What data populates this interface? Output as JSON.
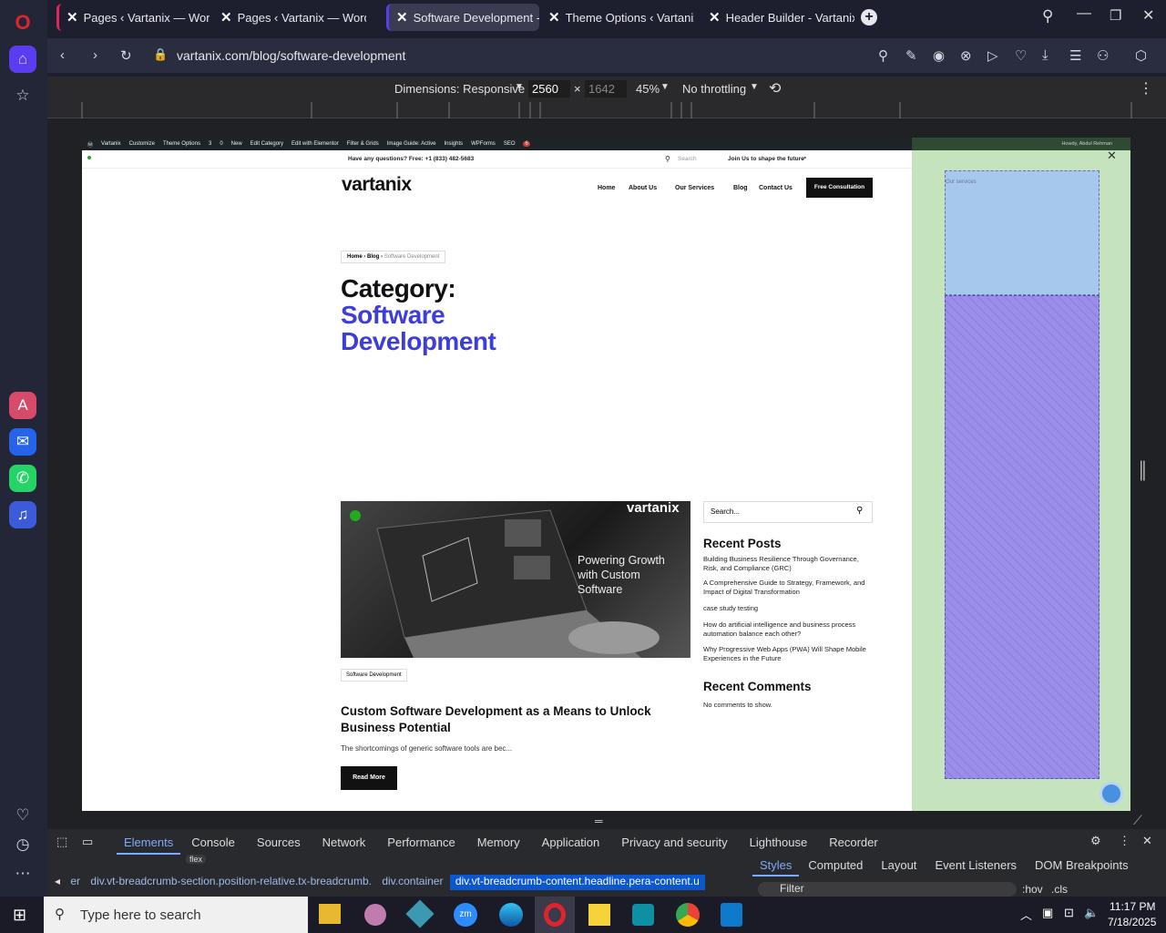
{
  "browser": {
    "tabs": [
      {
        "title": "Pages ‹ Vartanix — WordP"
      },
      {
        "title": "Pages ‹ Vartanix — WordP"
      },
      {
        "title": "Software Development - V"
      },
      {
        "title": "Theme Options ‹ Vartanix"
      },
      {
        "title": "Header Builder - Vartanix"
      }
    ],
    "url": "vartanix.com/blog/software-development"
  },
  "devtools_toolbar": {
    "dimensions": "Dimensions: Responsive",
    "width": "2560",
    "height": "1642",
    "zoom": "45%",
    "throttling": "No throttling"
  },
  "wp_admin": {
    "items": [
      "Vartanix",
      "Customize",
      "Theme Options",
      "3",
      "0",
      "New",
      "Edit Category",
      "Edit with Elementor",
      "Filter & Grids",
      "Image Guide: Active",
      "Insights",
      "WPForms",
      "SEO"
    ],
    "seo_badge": "6",
    "howdy": "Howdy, Abdul Rehman"
  },
  "site": {
    "topbar_question": "Have any questions? Free: +1 (833) 482-5683",
    "topbar_search": "Search",
    "topbar_join": "Join Us to shape the future",
    "logo": "vartanix",
    "nav": [
      "Home",
      "About Us",
      "Our Services",
      "Blog",
      "Contact Us"
    ],
    "cta": "Free Consultation",
    "breadcrumb": [
      "Home",
      "Blog",
      "Software Development"
    ],
    "category_label": "Category:",
    "category_name_1": "Software",
    "category_name_2": "Development",
    "post": {
      "image_logo": "vartanix",
      "image_text": "Powering Growth with Custom Software",
      "tag": "Software Development",
      "title": "Custom Software Development as a Means to Unlock Business Potential",
      "excerpt": "The shortcomings of generic software tools are bec...",
      "read_more": "Read More"
    },
    "sidebar": {
      "search_placeholder": "Search...",
      "recent_posts_title": "Recent Posts",
      "recent_posts": [
        "Building Business Resilience Through Governance, Risk, and Compliance (GRC)",
        "A Comprehensive Guide to Strategy, Framework, and Impact of Digital Transformation",
        "case study testing",
        "How do artificial intelligence and business process automation balance each other?",
        "Why Progressive Web Apps (PWA) Will Shape Mobile Experiences in the Future"
      ],
      "recent_comments_title": "Recent Comments",
      "no_comments": "No comments to show."
    },
    "overlay_label": "Our services"
  },
  "devtools": {
    "tabs": [
      "Elements",
      "Console",
      "Sources",
      "Network",
      "Performance",
      "Memory",
      "Application",
      "Privacy and security",
      "Lighthouse",
      "Recorder"
    ],
    "flex_badge": "flex",
    "crumbs": [
      "er",
      "div.vt-breadcrumb-section.position-relative.tx-breadcrumb.",
      "div.container",
      "div.vt-breadcrumb-content.headline.pera-content.u"
    ],
    "style_tabs": [
      "Styles",
      "Computed",
      "Layout",
      "Event Listeners",
      "DOM Breakpoints"
    ],
    "filter": "Filter",
    "hov": ":hov",
    "cls": ".cls"
  },
  "taskbar": {
    "search": "Type here to search",
    "time": "11:17 PM",
    "date": "7/18/2025"
  },
  "colors": {
    "accent": "#3d3ddb",
    "green_panel": "#c5e4bd",
    "overlay_blue": "#a6c8ec",
    "overlay_purple": "#9a8ee8"
  }
}
